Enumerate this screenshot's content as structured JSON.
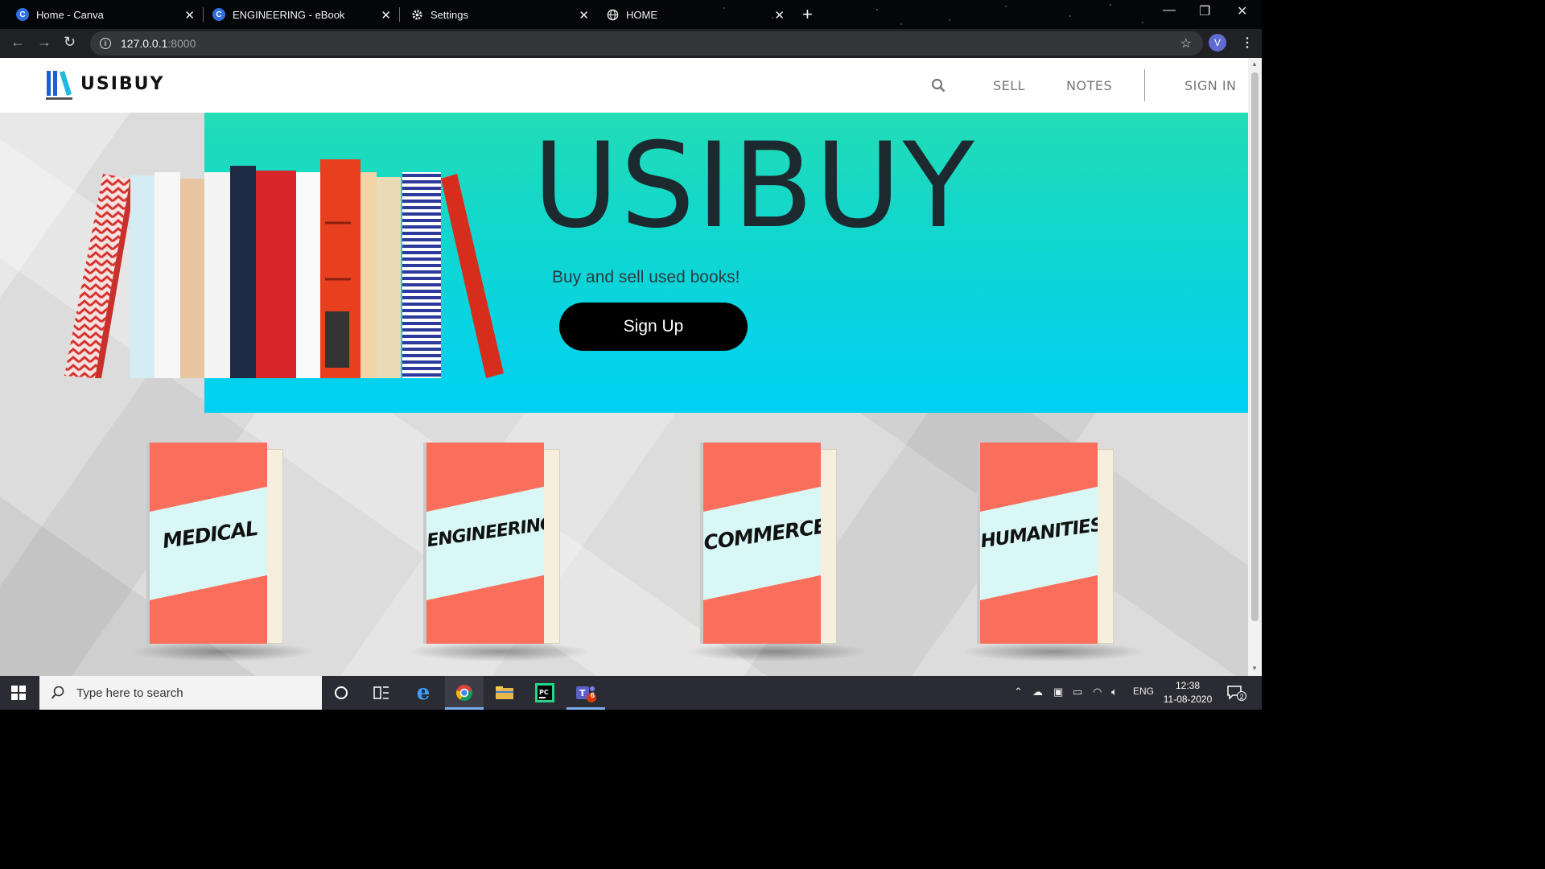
{
  "browser": {
    "tabs": [
      {
        "title": "Home - Canva",
        "icon": "canva-icon",
        "icon_letter": "C",
        "icon_color": "#2f6fe0"
      },
      {
        "title": "ENGINEERING - eBook",
        "icon": "canva-icon",
        "icon_letter": "C",
        "icon_color": "#2f6fe0"
      },
      {
        "title": "Settings",
        "icon": "gear-icon"
      },
      {
        "title": "HOME",
        "icon": "globe-icon"
      }
    ],
    "address": {
      "host": "127.0.0.1",
      "port": ":8000"
    },
    "profile_initial": "V"
  },
  "site": {
    "brand": "USIBUY",
    "nav": {
      "sell": "SELL",
      "notes": "NOTES",
      "sign_in": "SIGN IN"
    },
    "hero": {
      "title": "USIBUY",
      "subtitle": "Buy and sell used books!",
      "cta": "Sign Up"
    },
    "categories": [
      {
        "label": "MEDICAL"
      },
      {
        "label": "ENGINEERING"
      },
      {
        "label": "COMMERCE"
      },
      {
        "label": "HUMANITIES"
      }
    ],
    "colors": {
      "hero_top": "#22dcb5",
      "hero_bottom": "#00d1f4",
      "cover": "#fa6f5b",
      "band": "#d8f7f5"
    }
  },
  "taskbar": {
    "search_placeholder": "Type here to search",
    "language": "ENG",
    "time": "12:38",
    "date": "11-08-2020",
    "teams_badge": "6",
    "notifications_badge": "2"
  }
}
